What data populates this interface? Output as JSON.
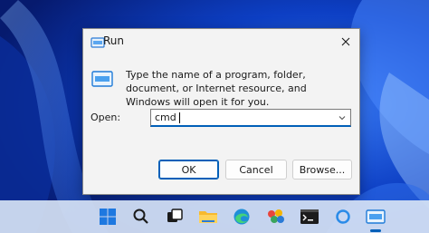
{
  "dialog": {
    "title": "Run",
    "description": "Type the name of a program, folder, document, or Internet resource, and Windows will open it for you.",
    "open_label": "Open:",
    "open_value": "cmd",
    "buttons": {
      "ok": "OK",
      "cancel": "Cancel",
      "browse": "Browse..."
    }
  },
  "icons": {
    "title": "run-icon",
    "body": "run-icon",
    "close": "close-icon",
    "dropdown": "chevron-down-icon"
  },
  "taskbar": {
    "items": [
      "start-icon",
      "search-icon",
      "task-view-icon",
      "file-explorer-icon",
      "edge-icon",
      "store-icon",
      "terminal-icon",
      "cortana-icon",
      "run-icon"
    ],
    "active": "run-icon"
  },
  "colors": {
    "accent": "#005fb8",
    "dialog_bg": "#f3f3f3",
    "taskbar_bg": "#d6e2f4"
  }
}
